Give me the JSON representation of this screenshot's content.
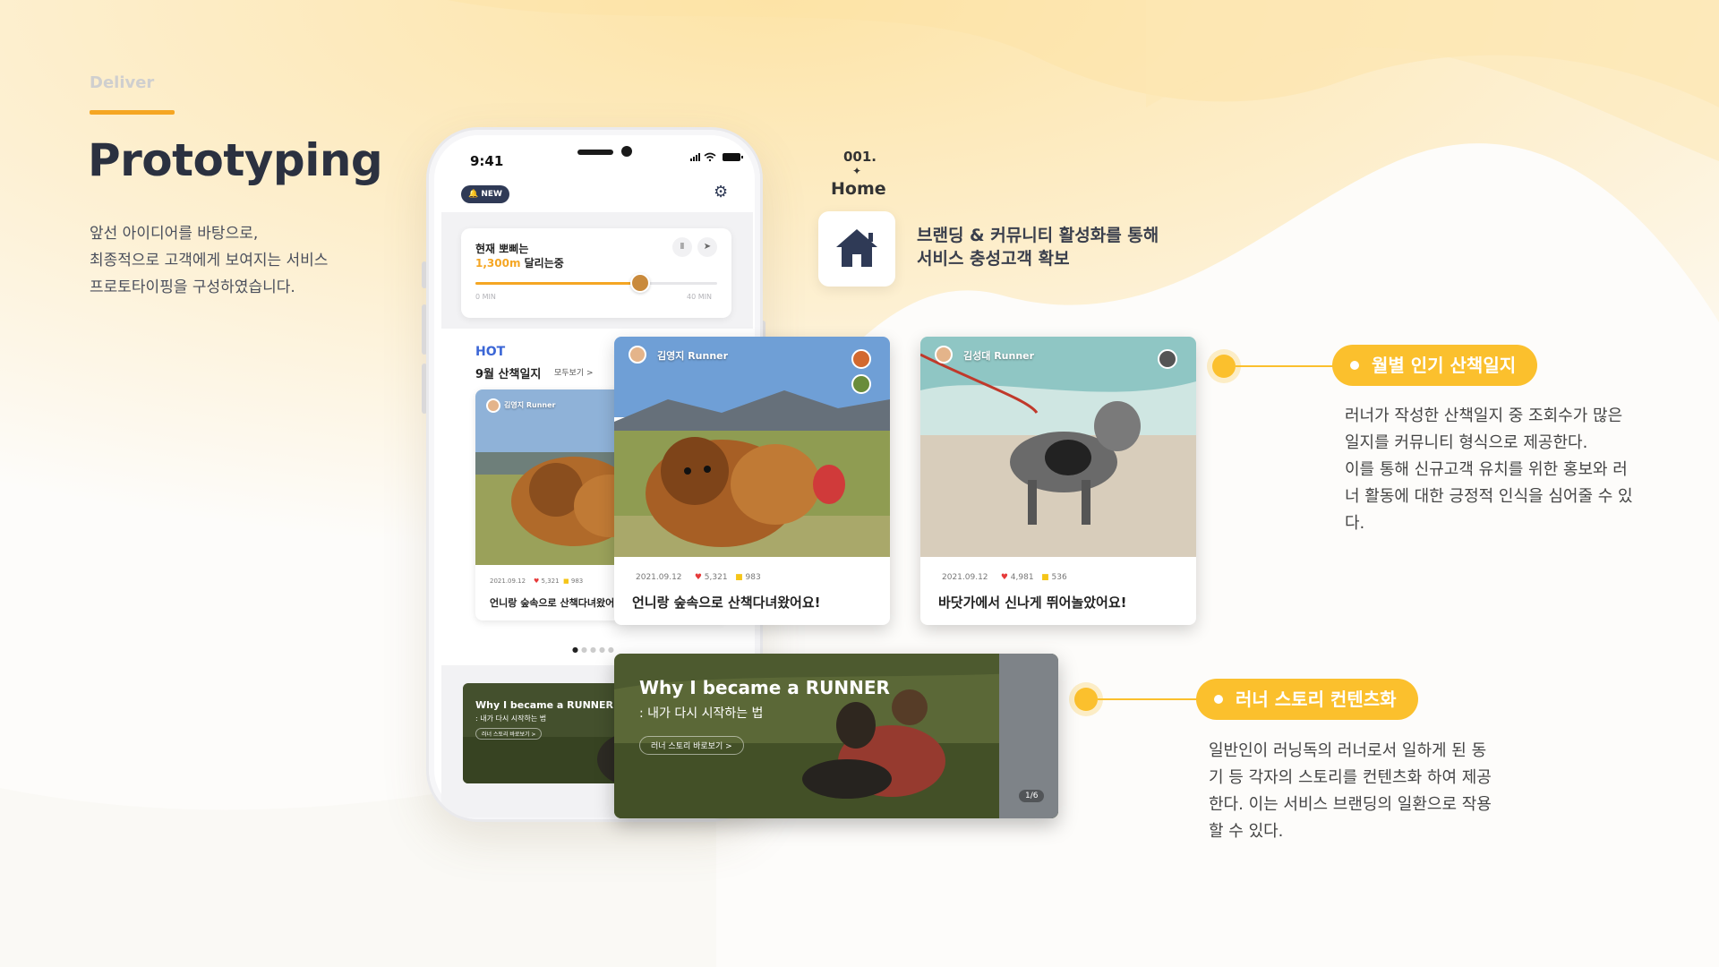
{
  "section": {
    "tag": "Deliver",
    "title": "Prototyping",
    "desc": [
      "앞선 아이디어를 바탕으로,",
      "최종적으로 고객에게 보여지는 서비스",
      "프로토타이핑을 구성하였습니다."
    ]
  },
  "phone": {
    "time": "9:41",
    "new_badge": "NEW",
    "running": {
      "line1": "현재 뽀삐는",
      "distance": "1,300m",
      "line2_rest": " 달리는중",
      "min_start": "0 MIN",
      "min_end": "40 MIN",
      "progress": 0.68
    },
    "hot": "HOT",
    "month_title": "9월 산책일지",
    "see_all": "모두보기 >",
    "card": {
      "author": "김영지 Runner",
      "date": "2021.09.12",
      "likes": "5,321",
      "comments": "983",
      "caption": "언니랑 숲속으로 산책다녀왔어요!"
    },
    "story": {
      "title": "Why I became a RUNNER",
      "subtitle": ": 내가 다시 시작하는 법",
      "link": "러너 스토리 바로보기 >"
    }
  },
  "card1": {
    "author": "김영지 Runner",
    "date": "2021.09.12",
    "likes": "5,321",
    "comments": "983",
    "caption": "언니랑 숲속으로 산책다녀왔어요!"
  },
  "card2": {
    "author": "김성대 Runner",
    "date": "2021.09.12",
    "likes": "4,981",
    "comments": "536",
    "caption": "바닷가에서 신나게 뛰어놀았어요!"
  },
  "story_big": {
    "title": "Why I became a RUNNER",
    "subtitle": ": 내가 다시 시작하는 법",
    "link": "러너 스토리 바로보기  >",
    "pager": "1/6"
  },
  "home": {
    "number": "001.",
    "star": "✦",
    "label": "Home",
    "desc": [
      "브랜딩 & 커뮤니티 활성화를 통해",
      "서비스 충성고객 확보"
    ]
  },
  "callout1": {
    "label": "월별 인기 산책일지",
    "desc": [
      "러너가 작성한 산책일지 중 조회수가 많은",
      "일지를 커뮤니티 형식으로 제공한다.",
      "이를 통해 신규고객 유치를 위한 홍보와 러",
      "너 활동에 대한 긍정적 인식을 심어줄 수 있",
      "다."
    ]
  },
  "callout2": {
    "label": "러너 스토리 컨텐츠화",
    "desc": [
      "일반인이 러닝독의 러너로서 일하게 된 동",
      "기 등 각자의 스토리를 컨텐츠화 하여 제공",
      "한다. 이는 서비스 브랜딩의 일환으로 작용",
      "할 수 있다."
    ]
  },
  "colors": {
    "accent": "#f5a623",
    "pill": "#fbc02d",
    "hot": "#3b66d6",
    "navy": "#2f3a56"
  },
  "icons": [
    "bell-icon",
    "gear-icon",
    "pause-icon",
    "send-icon",
    "heart-icon",
    "comment-icon",
    "home-icon",
    "chevron-right-icon"
  ]
}
